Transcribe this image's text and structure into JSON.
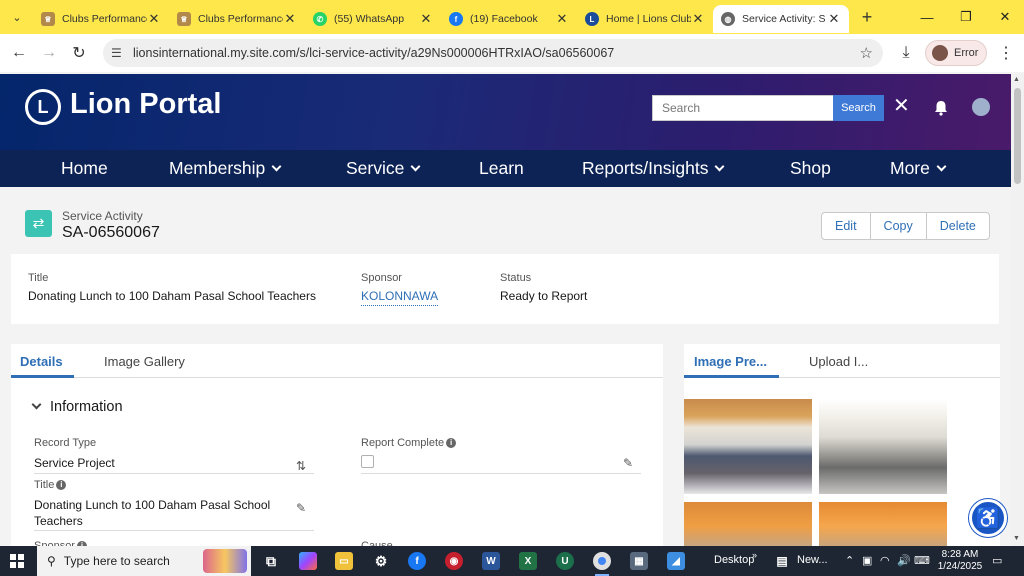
{
  "browser": {
    "tabs": [
      {
        "title": "Clubs Performance",
        "icon": "lions-club-icon",
        "color": "#b2894a"
      },
      {
        "title": "Clubs Performance",
        "icon": "lions-club-icon",
        "color": "#b2894a"
      },
      {
        "title": "(55) WhatsApp",
        "icon": "whatsapp-icon",
        "color": "#25d366"
      },
      {
        "title": "(19) Facebook",
        "icon": "facebook-icon",
        "color": "#1877f2"
      },
      {
        "title": "Home | Lions Club",
        "icon": "lions-logo-icon",
        "color": "#1b4c9b"
      },
      {
        "title": "Service Activity: S",
        "icon": "globe-icon",
        "color": "#666666",
        "active": true
      }
    ],
    "new_tab": "+",
    "url": "lionsinternational.my.site.com/s/lci-service-activity/a29Ns000006HTRxIAO/sa06560067",
    "profile_label": "Error"
  },
  "portal": {
    "brand": "Lion Portal",
    "logo_letter": "L",
    "search_placeholder": "Search",
    "search_button": "Search",
    "nav": [
      "Home",
      "Membership",
      "Service",
      "Learn",
      "Reports/Insights",
      "Shop",
      "More"
    ]
  },
  "record": {
    "type_label": "Service Activity",
    "name": "SA-06560067",
    "actions": [
      "Edit",
      "Copy",
      "Delete"
    ],
    "highlights": [
      {
        "label": "Title",
        "value": "Donating Lunch to 100 Daham Pasal School Teachers"
      },
      {
        "label": "Sponsor",
        "value": "KOLONNAWA"
      },
      {
        "label": "Status",
        "value": "Ready to Report"
      }
    ]
  },
  "details": {
    "tabs": [
      "Details",
      "Image Gallery"
    ],
    "section": "Information",
    "fields": {
      "record_type_label": "Record Type",
      "record_type_value": "Service Project",
      "report_complete_label": "Report Complete",
      "title_label": "Title",
      "title_value": "Donating Lunch to 100 Daham Pasal School Teachers",
      "sponsor_label": "Sponsor",
      "cause_label": "Cause"
    }
  },
  "images": {
    "tabs": [
      "Image Pre...",
      "Upload I..."
    ]
  },
  "taskbar": {
    "search_placeholder": "Type here to search",
    "desktop_label": "Desktop",
    "news_label": "New...",
    "time": "8:28 AM",
    "date": "1/24/2025",
    "colors": {
      "bg": "#1e2633",
      "accent": "#7fb3ff"
    }
  }
}
